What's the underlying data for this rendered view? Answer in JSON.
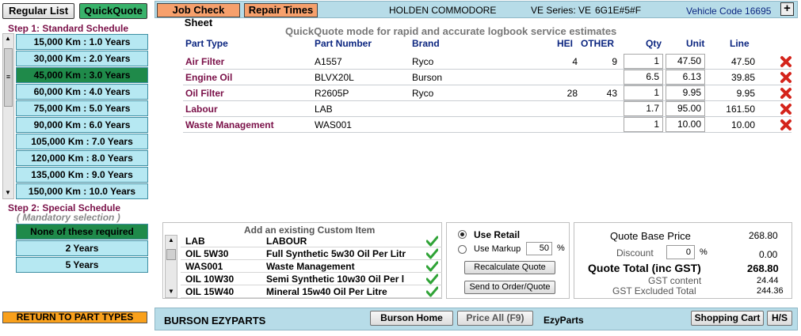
{
  "tabs": {
    "regular_list": "Regular List",
    "quickquote": "QuickQuote"
  },
  "toolbar": {
    "job_check_sheet": "Job Check Sheet",
    "repair_times": "Repair Times",
    "vehicle_model": "HOLDEN COMMODORE",
    "series": "VE Series: VE",
    "engine_code": "6G1E#5#F",
    "vehicle_code": "Vehicle Code 16695",
    "add_symbol": "+"
  },
  "step1_label": "Step 1: Standard Schedule",
  "schedule": [
    {
      "label": "15,000 Km  :  1.0 Years",
      "selected": false
    },
    {
      "label": "30,000 Km  :  2.0 Years",
      "selected": false
    },
    {
      "label": "45,000 Km  :  3.0 Years",
      "selected": true
    },
    {
      "label": "60,000 Km  :  4.0 Years",
      "selected": false
    },
    {
      "label": "75,000 Km  :  5.0 Years",
      "selected": false
    },
    {
      "label": "90,000 Km  :  6.0 Years",
      "selected": false
    },
    {
      "label": "105,000 Km  :  7.0 Years",
      "selected": false
    },
    {
      "label": "120,000 Km  :  8.0 Years",
      "selected": false
    },
    {
      "label": "135,000 Km  :  9.0 Years",
      "selected": false
    },
    {
      "label": "150,000 Km  :  10.0 Years",
      "selected": false
    }
  ],
  "scroll_arrows": {
    "up": "▲",
    "mid": "≡",
    "down": "▼"
  },
  "step2_label": "Step 2: Special Schedule",
  "step2_sub": "( Mandatory selection )",
  "special": [
    {
      "label": "None of these required",
      "selected": true
    },
    {
      "label": "2 Years",
      "selected": false
    },
    {
      "label": "5 Years",
      "selected": false
    }
  ],
  "heading": "QuickQuote mode for rapid and accurate logbook service estimates",
  "table_headers": {
    "part_type": "Part Type",
    "part_number": "Part Number",
    "brand": "Brand",
    "hei": "HEI",
    "other": "OTHER",
    "qty": "Qty",
    "unit": "Unit",
    "line": "Line"
  },
  "rows": [
    {
      "part_type": "Air Filter",
      "part_number": "A1557",
      "brand": "Ryco",
      "hei": "4",
      "other": "9",
      "qty": "1",
      "unit": "47.50",
      "line": "47.50"
    },
    {
      "part_type": "Engine Oil",
      "part_number": "BLVX20L",
      "brand": "Burson",
      "hei": "",
      "other": "",
      "qty": "6.5",
      "unit": "6.13",
      "line": "39.85"
    },
    {
      "part_type": "Oil Filter",
      "part_number": "R2605P",
      "brand": "Ryco",
      "hei": "28",
      "other": "43",
      "qty": "1",
      "unit": "9.95",
      "line": "9.95"
    },
    {
      "part_type": "Labour",
      "part_number": "LAB",
      "brand": "",
      "hei": "",
      "other": "",
      "qty": "1.7",
      "unit": "95.00",
      "line": "161.50"
    },
    {
      "part_type": "Waste Management",
      "part_number": "WAS001",
      "brand": "",
      "hei": "",
      "other": "",
      "qty": "1",
      "unit": "10.00",
      "line": "10.00"
    }
  ],
  "custom": {
    "title": "Add an existing Custom Item",
    "items": [
      {
        "code": "LAB",
        "desc": "LABOUR"
      },
      {
        "code": "OIL 5W30",
        "desc": "Full Synthetic 5w30 Oil Per Litr"
      },
      {
        "code": "WAS001",
        "desc": "Waste Management"
      },
      {
        "code": "OIL 10W30",
        "desc": "Semi Synthetic 10w30 Oil Per l"
      },
      {
        "code": "OIL 15W40",
        "desc": "Mineral 15w40 Oil Per Litre"
      }
    ]
  },
  "pricing": {
    "use_retail": "Use Retail",
    "use_markup": "Use Markup",
    "markup_value": "50",
    "percent": "%",
    "recalc": "Recalculate Quote",
    "send": "Send to Order/Quote"
  },
  "summary": {
    "base_label": "Quote Base Price",
    "base_value": "268.80",
    "discount_label": "Discount",
    "discount_input": "0",
    "discount_pct": "%",
    "discount_value": "0.00",
    "total_label": "Quote Total (inc GST)",
    "total_value": "268.80",
    "gst_label": "GST content",
    "gst_value": "24.44",
    "ex_label": "GST Excluded Total",
    "ex_value": "244.36"
  },
  "bottom": {
    "return": "RETURN TO PART TYPES",
    "brand": "BURSON EZYPARTS",
    "burson_home": "Burson Home",
    "price_all": "Price All (F9)",
    "ezyparts": "EzyParts",
    "cart": "Shopping Cart",
    "hs": "H/S"
  },
  "colors": {
    "accent_blue": "#b7dce8",
    "schedule_bg": "#b6e8f2",
    "selected_green": "#1f8a4a",
    "part_type": "#7a1048",
    "header_blue": "#0c2680",
    "orange": "#f6a06c"
  }
}
